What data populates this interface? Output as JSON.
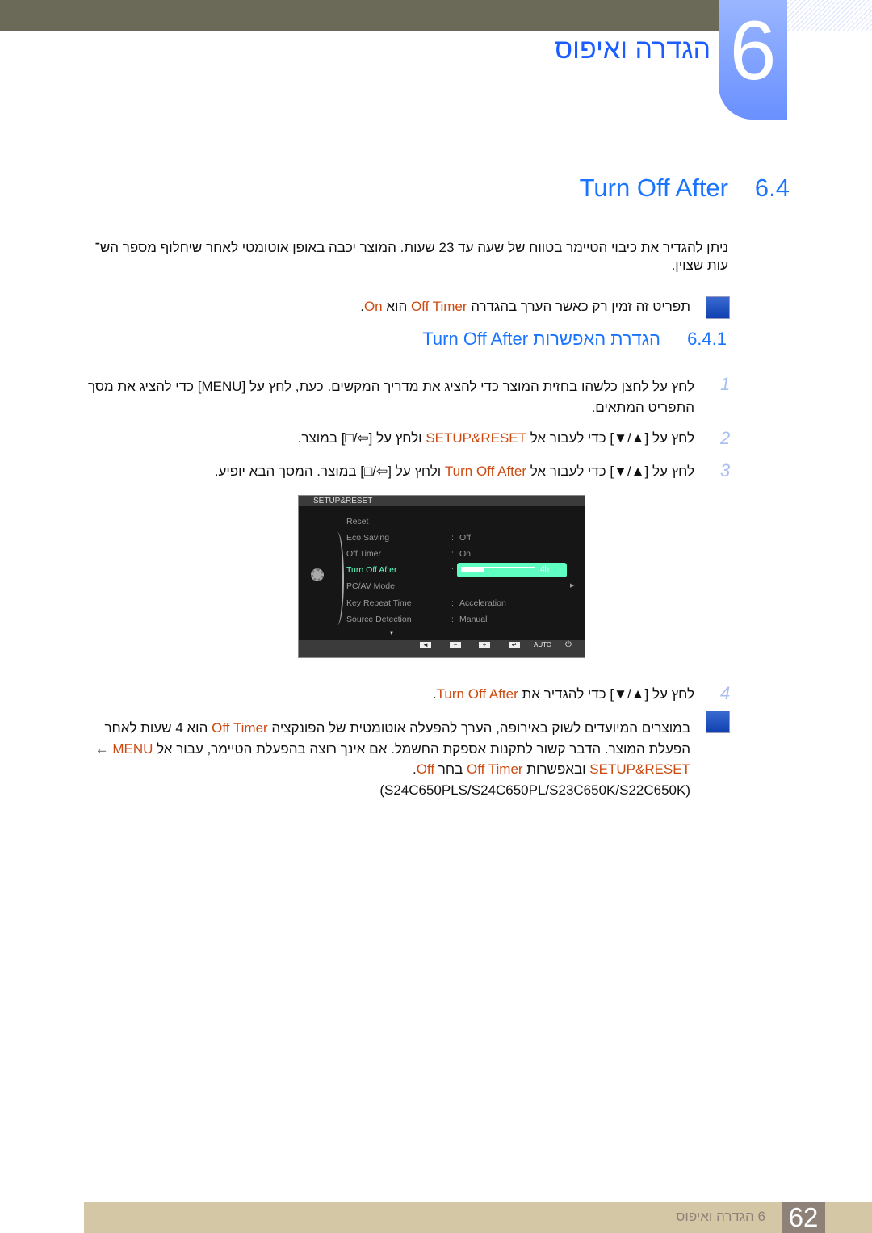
{
  "header": {
    "chapter_number": "6",
    "chapter_title": "הגדרה ואיפוס"
  },
  "section": {
    "number": "6.4",
    "title": "Turn Off After"
  },
  "intro": [
    "ניתן להגדיר את כיבוי הטיימר בטווח של שעה עד 23 שעות. המוצר יכבה באופן אוטומטי לאחר שיחלוף מספר הש־",
    "עות שצוין."
  ],
  "note1": {
    "icon": "note-pencil-icon",
    "seg": [
      "תפריט זה זמין רק כאשר הערך בהגדרה ",
      "Off Timer",
      " הוא ",
      "On",
      "."
    ]
  },
  "subsection": {
    "number": "6.4.1",
    "title": "הגדרת האפשרות Turn Off After"
  },
  "steps": [
    {
      "num": "1",
      "lines": [
        "לחץ על לחצן כלשהו בחזית המוצר כדי להציג את מדריך המקשים. כעת, לחץ על [MENU] כדי להציג את מסך",
        "התפריט המתאים."
      ]
    },
    {
      "num": "2",
      "seg": [
        "לחץ על [▲/▼] כדי לעבור אל ",
        "SETUP&RESET",
        " ולחץ על [⇦/□] במוצר."
      ]
    },
    {
      "num": "3",
      "seg": [
        "לחץ על [▲/▼] כדי לעבור אל ",
        "Turn Off After",
        " ולחץ על [⇦/□] במוצר. המסך הבא יופיע."
      ]
    },
    {
      "num": "4",
      "seg": [
        "לחץ על [▲/▼] כדי להגדיר את ",
        "Turn Off After",
        "."
      ]
    }
  ],
  "osd": {
    "title": "SETUP&RESET",
    "items": [
      {
        "label": "Reset",
        "value": ""
      },
      {
        "label": "Eco Saving",
        "value": "Off"
      },
      {
        "label": "Off Timer",
        "value": "On"
      },
      {
        "label": "Turn Off After",
        "value": "4h",
        "selected": true,
        "slider_fraction": 0.3
      },
      {
        "label": "PC/AV Mode",
        "value": ""
      },
      {
        "label": "Key Repeat Time",
        "value": "Acceleration"
      },
      {
        "label": "Source Detection",
        "value": "Manual"
      }
    ],
    "buttons": [
      "◄",
      "−",
      "+",
      "↵",
      "AUTO",
      "⏻"
    ],
    "highlight_color": "#5effc0"
  },
  "note2": {
    "l1": [
      "במוצרים המיועדים לשוק באירופה, הערך להפעלה אוטומטית של הפונקציה ",
      "Off Timer",
      " הוא 4 שעות לאחר"
    ],
    "l2": [
      "הפעלת המוצר. הדבר קשור לתקנות אספקת החשמל. אם אינך רוצה בהפעלת הטיימר, עבור אל ",
      "MENU",
      " ←"
    ],
    "l3": [
      "SETUP&RESET",
      " ובאפשרות ",
      "Off Timer",
      " בחר ",
      "Off",
      "."
    ],
    "l4": "(S24C650PLS/S24C650PL/S23C650K/S22C650K)"
  },
  "footer": {
    "chapter": "6 הגדרה ואיפוס",
    "page": "62"
  },
  "colors": {
    "accent": "#cc4a10",
    "heading": "#1a5cff",
    "footer": "#d4c7a6"
  }
}
